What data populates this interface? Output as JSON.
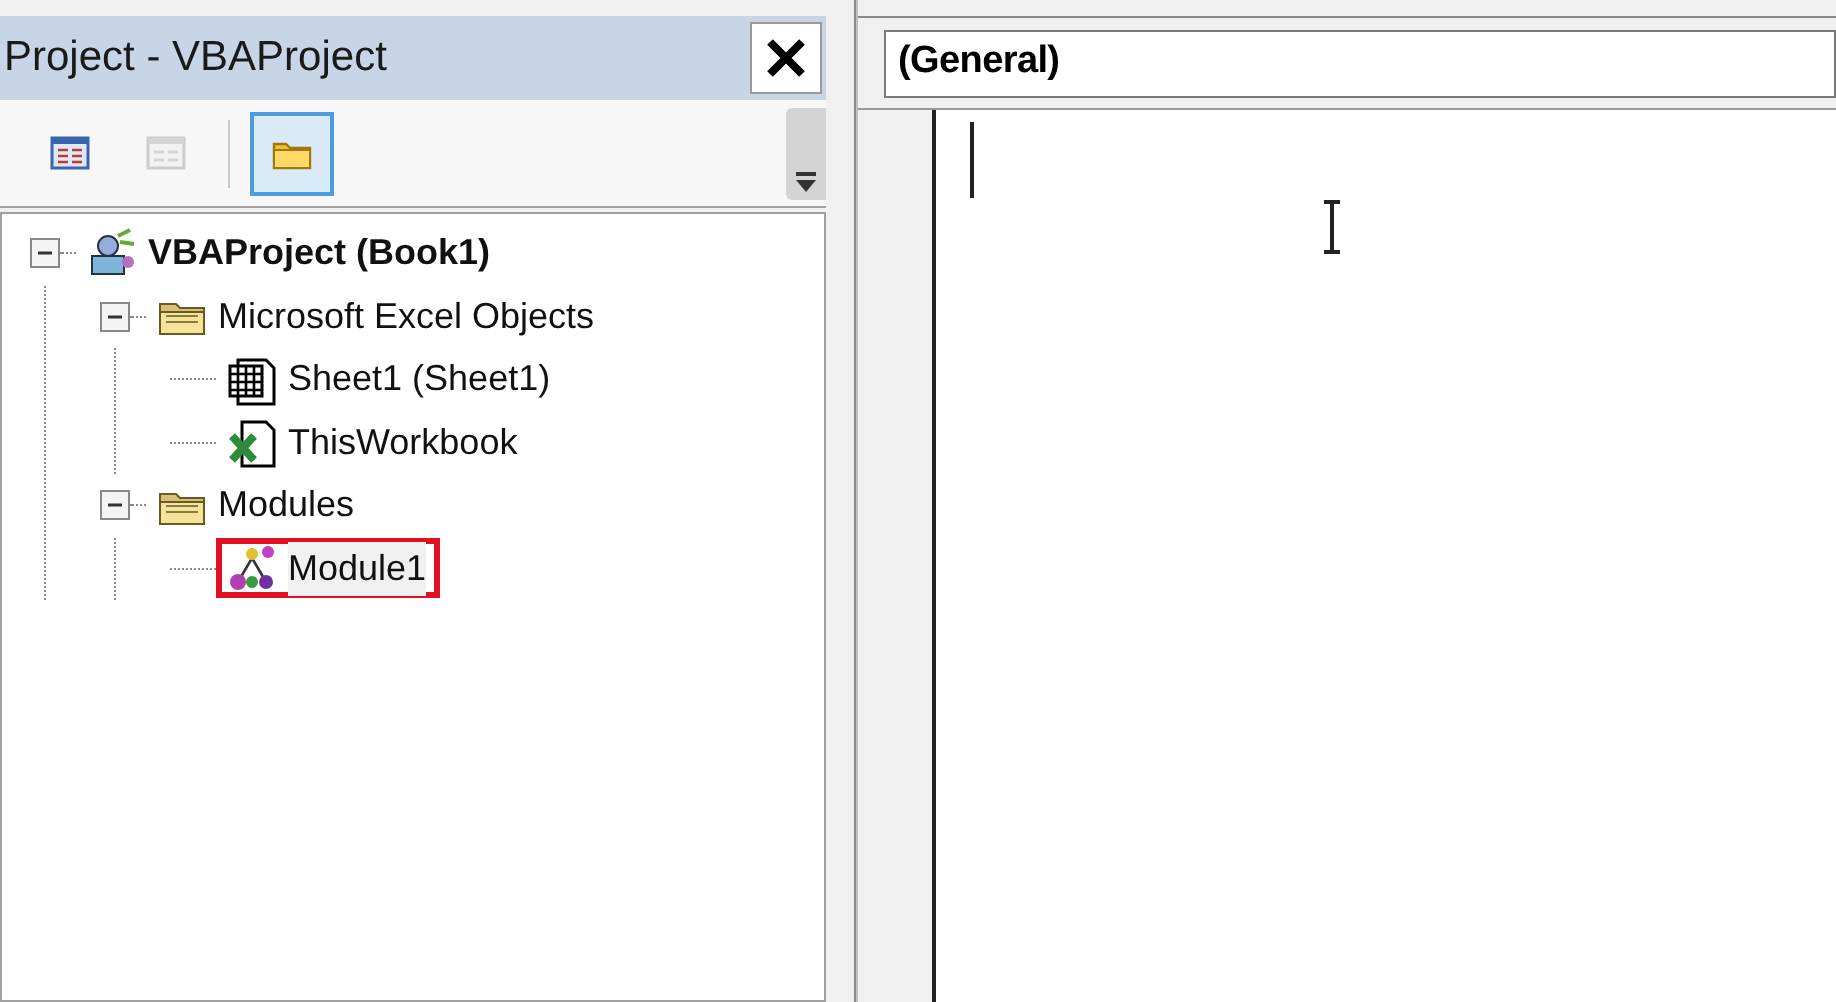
{
  "project_panel": {
    "title": "Project - VBAProject",
    "toolbar": [
      {
        "kind": "view-code",
        "selected": false,
        "disabled": false
      },
      {
        "kind": "view-object",
        "selected": false,
        "disabled": true
      },
      {
        "kind": "toggle-folders",
        "selected": true,
        "disabled": false
      }
    ],
    "tree": [
      {
        "kind": "project",
        "label": "VBAProject (Book1)",
        "expanded": true,
        "selected": false,
        "children": [
          {
            "kind": "folder",
            "label": "Microsoft Excel Objects",
            "expanded": true,
            "selected": false,
            "children": [
              {
                "kind": "sheet",
                "label": "Sheet1 (Sheet1)",
                "selected": false
              },
              {
                "kind": "workbook",
                "label": "ThisWorkbook",
                "selected": false
              }
            ]
          },
          {
            "kind": "folder",
            "label": "Modules",
            "expanded": true,
            "selected": false,
            "children": [
              {
                "kind": "module",
                "label": "Module1",
                "selected": true
              }
            ]
          }
        ]
      }
    ]
  },
  "code_window": {
    "object_dropdown": "(General)"
  }
}
